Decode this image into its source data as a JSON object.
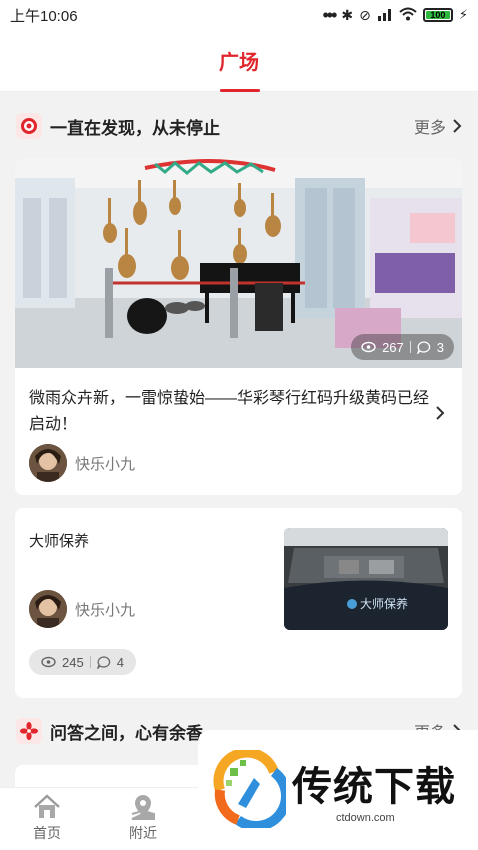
{
  "status_bar": {
    "time": "上午10:06",
    "battery_level": "100"
  },
  "header": {
    "active_tab": "广场"
  },
  "section1": {
    "title": "一直在发现，从未停止",
    "more_label": "更多"
  },
  "post1": {
    "title": "微雨众卉新，一雷惊蛰始——华彩琴行红码升级黄码已经启动！",
    "views": "267",
    "comments": "3",
    "author": "快乐小九"
  },
  "post2": {
    "title": "大师保养",
    "views": "245",
    "comments": "4",
    "author": "快乐小九"
  },
  "section2": {
    "title": "问答之间，心有余香",
    "more_label": "更多"
  },
  "bottom_nav": [
    {
      "label": "首页",
      "icon": "home-icon"
    },
    {
      "label": "附近",
      "icon": "location-icon"
    }
  ],
  "watermark": {
    "brand": "传统下载",
    "url": "ctdown.com"
  },
  "colors": {
    "accent": "#e0262c",
    "background": "#f2f2f2"
  }
}
